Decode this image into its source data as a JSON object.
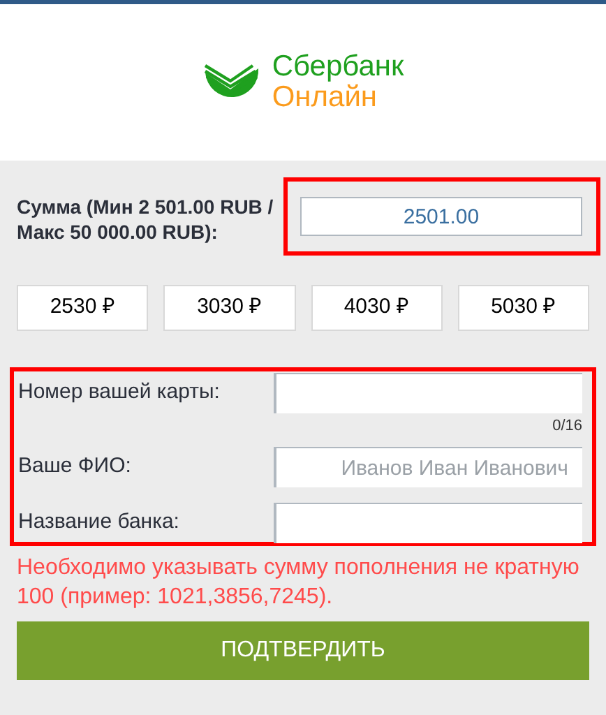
{
  "logo": {
    "line_1": "Сбербанк",
    "line_2": "Онлайн"
  },
  "amount": {
    "label": "Сумма (Мин 2 501.00 RUB / Макс 50 000.00 RUB):",
    "value": "2501.00"
  },
  "presets": [
    "2530 ₽",
    "3030 ₽",
    "4030 ₽",
    "5030 ₽"
  ],
  "fields": [
    {
      "label": "Номер вашей карты:",
      "counter": "0/16"
    },
    {
      "label": "Ваше ФИО:",
      "placeholder": "Иванов Иван Иванович"
    },
    {
      "label": "Название банка:"
    }
  ],
  "error": "Необходимо указывать сумму пополнения не кратную 100 (пример: 1021,3856,7245).",
  "submit": "ПОДТВЕРДИТЬ"
}
